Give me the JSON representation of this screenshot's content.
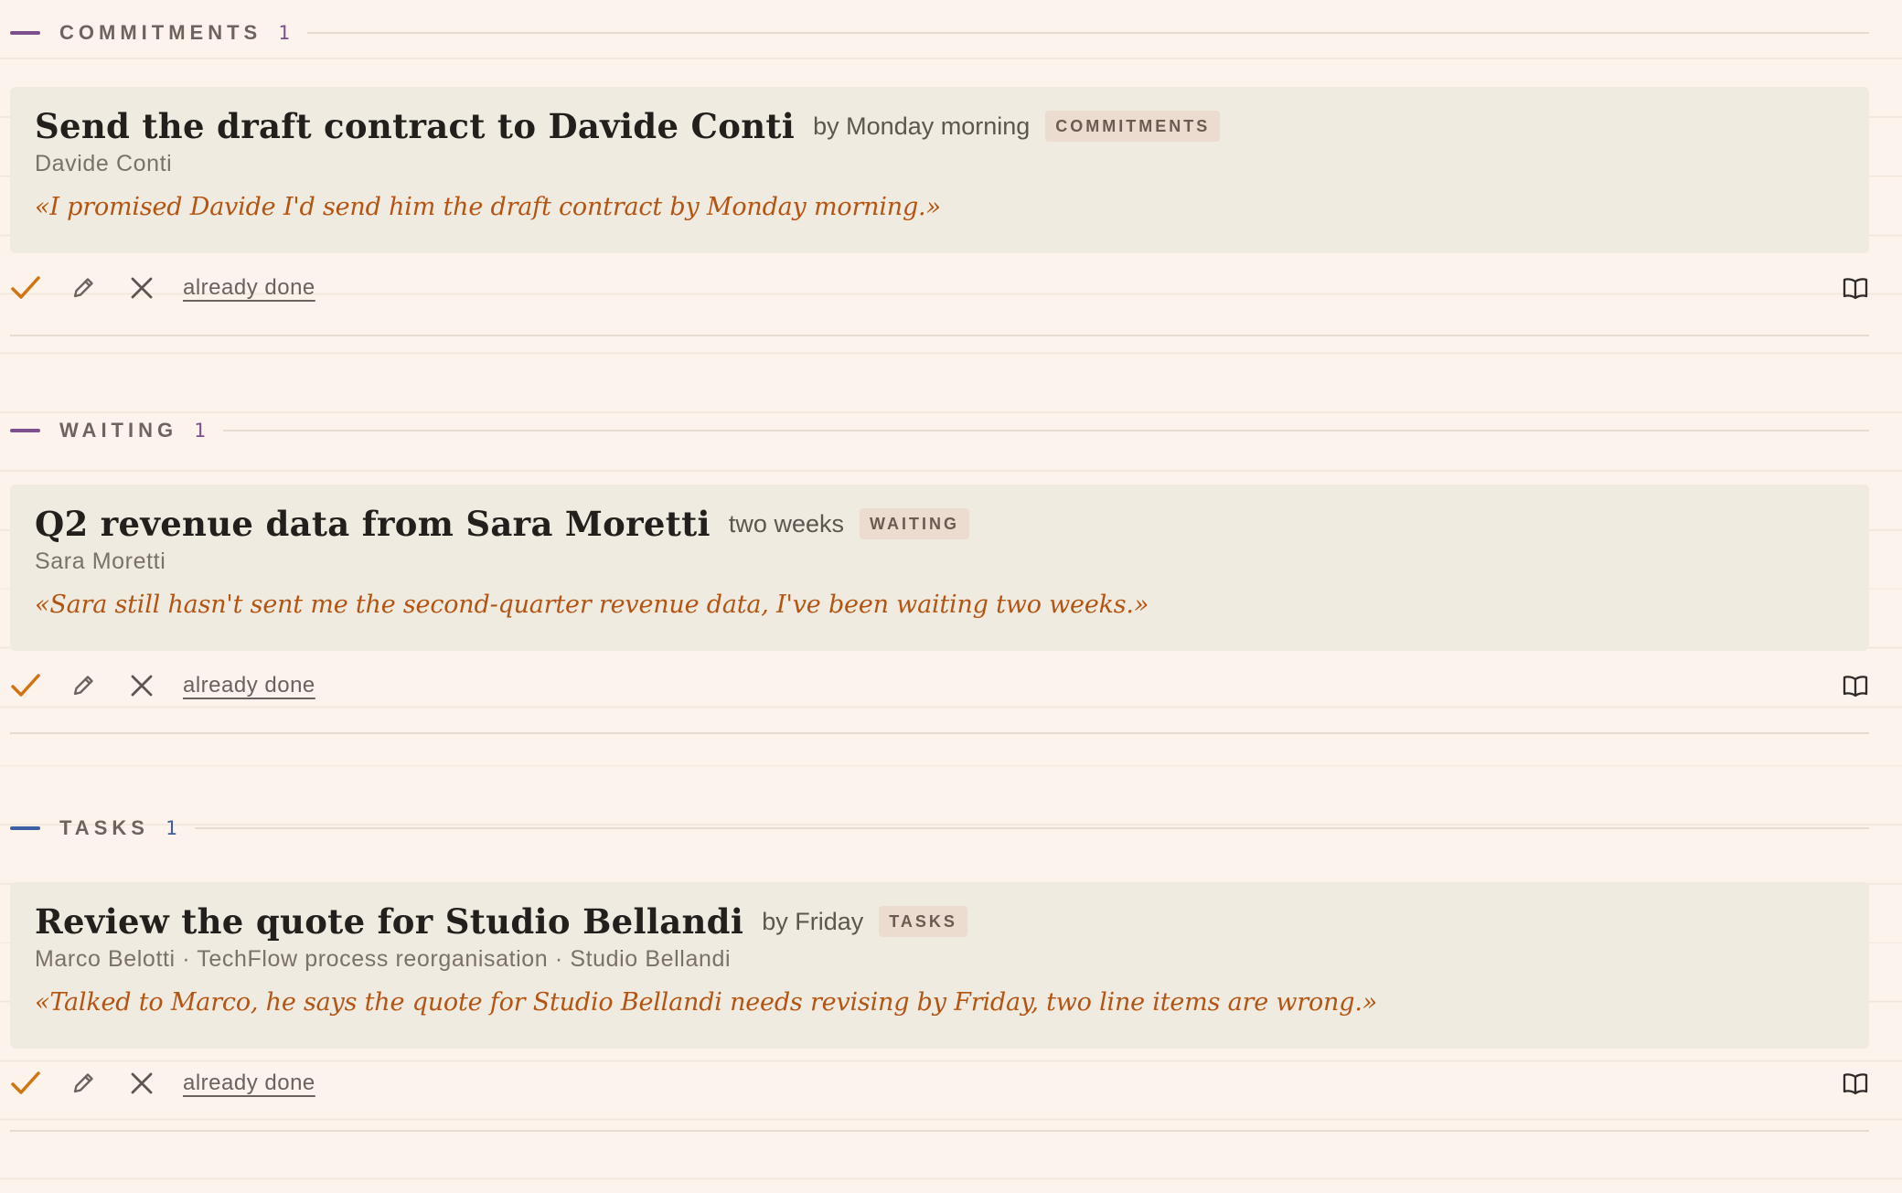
{
  "colors": {
    "commitments_accent": "#7d4f8e",
    "waiting_accent": "#7d4f8e",
    "tasks_accent": "#3e5fa3",
    "quote": "#b45412",
    "check": "#d2740f"
  },
  "sections": [
    {
      "title": "COMMITMENTS",
      "count": "1",
      "item": {
        "title": "Send the draft contract to Davide Conti",
        "due": "by Monday morning",
        "tag": "COMMITMENTS",
        "people": "Davide Conti",
        "quote": "«I promised Davide I'd send him the draft contract by Monday morning.»",
        "done_label": "already done"
      }
    },
    {
      "title": "WAITING",
      "count": "1",
      "item": {
        "title": "Q2 revenue data from Sara Moretti",
        "due": "two weeks",
        "tag": "WAITING",
        "people": "Sara Moretti",
        "quote": "«Sara still hasn't sent me the second-quarter revenue data, I've been waiting two weeks.»",
        "done_label": "already done"
      }
    },
    {
      "title": "TASKS",
      "count": "1",
      "item": {
        "title": "Review the quote for Studio Bellandi",
        "due": "by Friday",
        "tag": "TASKS",
        "people": "Marco Belotti · TechFlow process reorganisation · Studio Bellandi",
        "quote": "«Talked to Marco, he says the quote for Studio Bellandi needs revising by Friday, two line items are wrong.»",
        "done_label": "already done"
      }
    }
  ],
  "icons": {
    "confirm": "check-icon",
    "edit": "pencil-icon",
    "dismiss": "close-icon",
    "source": "book-icon"
  }
}
